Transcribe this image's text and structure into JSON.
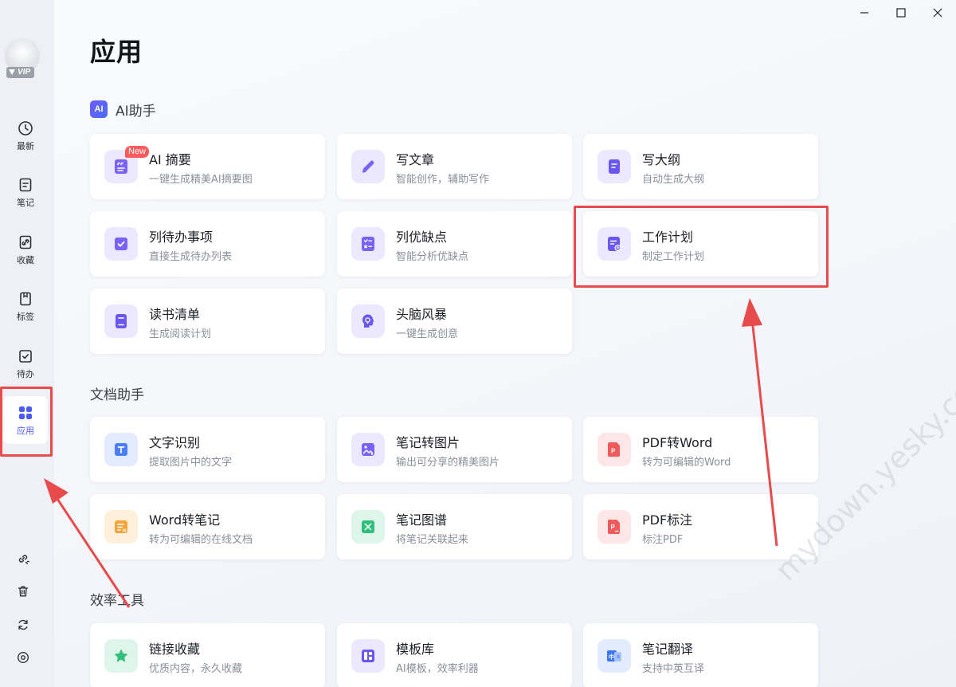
{
  "sidebar": {
    "vip_label": "VIP",
    "nav": [
      {
        "label": "最新",
        "icon": "clock-icon"
      },
      {
        "label": "笔记",
        "icon": "note-icon"
      },
      {
        "label": "收藏",
        "icon": "link-icon"
      },
      {
        "label": "标签",
        "icon": "bookmark-icon"
      },
      {
        "label": "待办",
        "icon": "checkbox-icon"
      },
      {
        "label": "应用",
        "icon": "apps-grid-icon",
        "active": true
      }
    ],
    "bottom_icons": [
      "broken-link-icon",
      "trash-icon",
      "sync-icon",
      "settings-icon"
    ]
  },
  "window_controls": [
    "minimize-icon",
    "maximize-icon",
    "close-icon"
  ],
  "page": {
    "title": "应用"
  },
  "sections": {
    "ai": {
      "badge": "AI",
      "title": "AI助手",
      "cards": [
        {
          "title": "AI 摘要",
          "desc": "一键生成精美AI摘要图",
          "badge": "New",
          "icon": "quote-doc-icon"
        },
        {
          "title": "写文章",
          "desc": "智能创作，辅助写作",
          "icon": "pencil-icon"
        },
        {
          "title": "写大纲",
          "desc": "自动生成大纲",
          "icon": "outline-doc-icon"
        },
        {
          "title": "列待办事项",
          "desc": "直接生成待办列表",
          "icon": "checkbox-icon"
        },
        {
          "title": "列优缺点",
          "desc": "智能分析优缺点",
          "icon": "pros-cons-icon"
        },
        {
          "title": "工作计划",
          "desc": "制定工作计划",
          "icon": "plan-doc-icon"
        },
        {
          "title": "读书清单",
          "desc": "生成阅读计划",
          "icon": "book-icon"
        },
        {
          "title": "头脑风暴",
          "desc": "一键生成创意",
          "icon": "brain-icon"
        }
      ]
    },
    "doc": {
      "title": "文档助手",
      "cards": [
        {
          "title": "文字识别",
          "desc": "提取图片中的文字",
          "icon": "text-ocr-icon"
        },
        {
          "title": "笔记转图片",
          "desc": "输出可分享的精美图片",
          "icon": "image-icon"
        },
        {
          "title": "PDF转Word",
          "desc": "转为可编辑的Word",
          "icon": "pdf-icon"
        },
        {
          "title": "Word转笔记",
          "desc": "转为可编辑的在线文档",
          "icon": "word-icon"
        },
        {
          "title": "笔记图谱",
          "desc": "将笔记关联起来",
          "icon": "graph-icon"
        },
        {
          "title": "PDF标注",
          "desc": "标注PDF",
          "icon": "pdf-annotate-icon"
        }
      ]
    },
    "efficiency": {
      "title": "效率工具",
      "cards": [
        {
          "title": "链接收藏",
          "desc": "优质内容，永久收藏",
          "icon": "star-icon"
        },
        {
          "title": "模板库",
          "desc": "AI模板，效率利器",
          "icon": "template-icon"
        },
        {
          "title": "笔记翻译",
          "desc": "支持中英互译",
          "icon": "translate-icon"
        }
      ]
    }
  },
  "watermark": "mydown.yesky.com 天极下载站",
  "colors": {
    "accent": "#4b5bf5",
    "highlight": "#e84b4b",
    "purple": "#6d5dfc"
  }
}
